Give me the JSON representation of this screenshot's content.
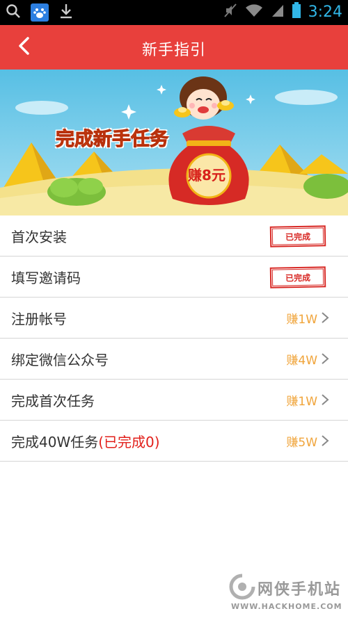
{
  "status_bar": {
    "time": "3:24",
    "icons": [
      "search-icon",
      "baidu-icon",
      "download-icon",
      "mute-icon",
      "wifi-icon",
      "signal-icon",
      "battery-icon"
    ]
  },
  "header": {
    "title": "新手指引",
    "back_icon": "chevron-left-icon",
    "bg_color": "#e8403c"
  },
  "banner": {
    "slogan": "完成新手任务",
    "bag_text": "赚8元"
  },
  "tasks": [
    {
      "label": "首次安装",
      "status": "已完成"
    },
    {
      "label": "填写邀请码",
      "status": "已完成"
    },
    {
      "label": "注册帐号",
      "reward": "赚1W"
    },
    {
      "label": "绑定微信公众号",
      "reward": "赚4W"
    },
    {
      "label": "完成首次任务",
      "reward": "赚1W"
    },
    {
      "label": "完成40W任务",
      "label_highlight": "(已完成0)",
      "reward": "赚5W"
    }
  ],
  "watermark": {
    "title": "网侠手机站",
    "url": "WWW.HACKHOME.COM"
  },
  "colors": {
    "reward": "#f0a43a",
    "stamp": "#d82a26",
    "highlight": "#e21f1a"
  }
}
